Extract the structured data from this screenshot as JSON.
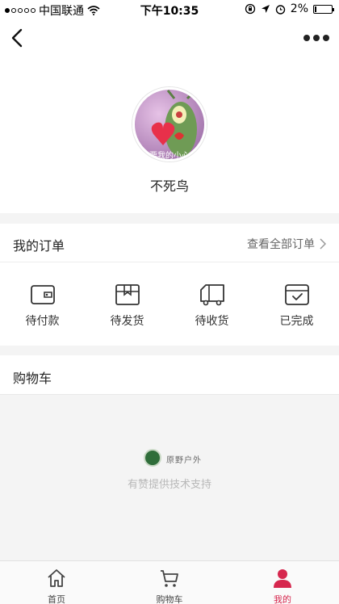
{
  "status_bar": {
    "carrier": "中国联通",
    "time": "下午10:35",
    "battery": "2%",
    "icons": [
      "signal-dots-icon",
      "wifi-icon",
      "orientation-lock-icon",
      "location-icon",
      "alarm-icon",
      "battery-icon"
    ]
  },
  "nav": {
    "icons": [
      "back-arrow-icon",
      "more-dots-icon"
    ]
  },
  "profile": {
    "username": "不死鸟",
    "avatar_caption": "要我的小心心"
  },
  "orders": {
    "title": "我的订单",
    "view_all": "查看全部订单",
    "items": [
      {
        "label": "待付款",
        "icon": "wallet-icon"
      },
      {
        "label": "待发货",
        "icon": "package-icon"
      },
      {
        "label": "待收货",
        "icon": "truck-icon"
      },
      {
        "label": "已完成",
        "icon": "calendar-check-icon"
      }
    ]
  },
  "cart": {
    "title": "购物车"
  },
  "footer": {
    "logo_text": "原野户外",
    "powered_by": "有赞提供技术支持"
  },
  "tab_bar": {
    "active_color": "#d6274e",
    "tabs": [
      {
        "label": "首页",
        "icon": "home-icon"
      },
      {
        "label": "购物车",
        "icon": "cart-icon"
      },
      {
        "label": "我的",
        "icon": "user-icon"
      }
    ]
  }
}
